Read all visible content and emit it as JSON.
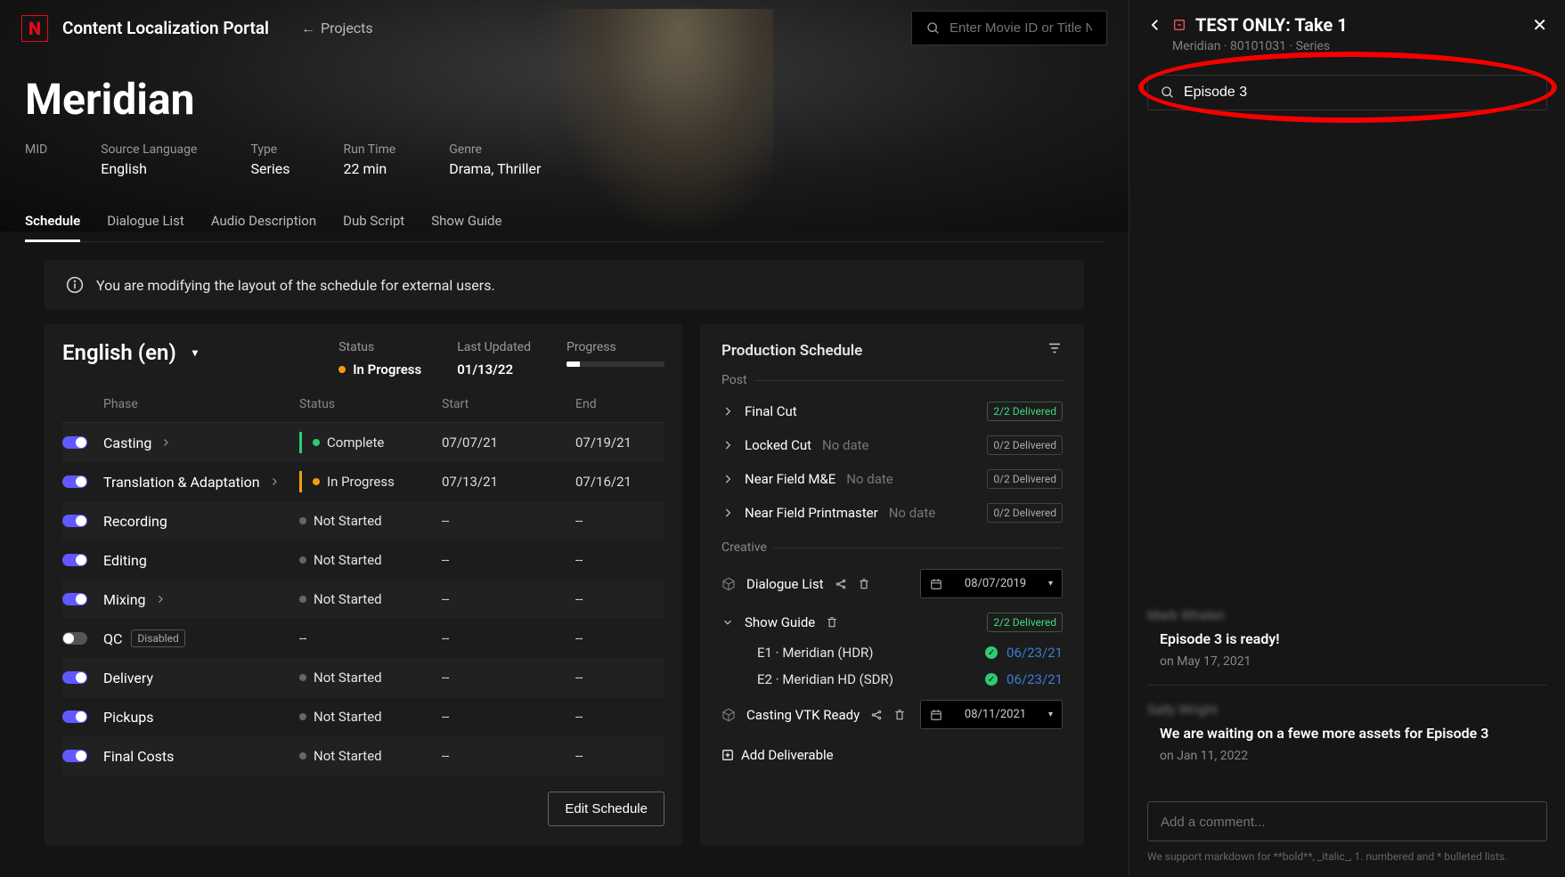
{
  "app": {
    "title": "Content Localization Portal",
    "projects_link": "Projects",
    "search_placeholder": "Enter Movie ID or Title Name"
  },
  "title": {
    "name": "Meridian",
    "meta": {
      "mid_label": "MID",
      "mid_value": "",
      "source_language_label": "Source Language",
      "source_language_value": "English",
      "type_label": "Type",
      "type_value": "Series",
      "runtime_label": "Run Time",
      "runtime_value": "22 min",
      "genre_label": "Genre",
      "genre_value": "Drama, Thriller"
    }
  },
  "tabs": {
    "schedule": "Schedule",
    "dialogue_list": "Dialogue List",
    "audio_description": "Audio Description",
    "dub_script": "Dub Script",
    "show_guide": "Show Guide"
  },
  "notice": "You are modifying the layout of the schedule for external users.",
  "schedule_panel": {
    "language": "English (en)",
    "status_label": "Status",
    "status_value": "In Progress",
    "last_updated_label": "Last Updated",
    "last_updated_value": "01/13/22",
    "progress_label": "Progress",
    "progress_pct": 14,
    "columns": {
      "phase": "Phase",
      "status": "Status",
      "start": "Start",
      "end": "End"
    },
    "phases": [
      {
        "name": "Casting",
        "status": "Complete",
        "start": "07/07/21",
        "end": "07/19/21",
        "enabled": true,
        "expandable": true,
        "dot": "green",
        "bar": "green"
      },
      {
        "name": "Translation & Adaptation",
        "status": "In Progress",
        "start": "07/13/21",
        "end": "07/16/21",
        "enabled": true,
        "expandable": true,
        "dot": "amber",
        "bar": "amber"
      },
      {
        "name": "Recording",
        "status": "Not Started",
        "start": "--",
        "end": "--",
        "enabled": true,
        "dot": "grey"
      },
      {
        "name": "Editing",
        "status": "Not Started",
        "start": "--",
        "end": "--",
        "enabled": true,
        "dot": "grey"
      },
      {
        "name": "Mixing",
        "status": "Not Started",
        "start": "--",
        "end": "--",
        "enabled": true,
        "expandable": true,
        "dot": "grey"
      },
      {
        "name": "QC",
        "status": "--",
        "start": "--",
        "end": "--",
        "enabled": false,
        "disabled_chip": "Disabled"
      },
      {
        "name": "Delivery",
        "status": "Not Started",
        "start": "--",
        "end": "--",
        "enabled": true,
        "dot": "grey"
      },
      {
        "name": "Pickups",
        "status": "Not Started",
        "start": "--",
        "end": "--",
        "enabled": true,
        "dot": "grey"
      },
      {
        "name": "Final Costs",
        "status": "Not Started",
        "start": "--",
        "end": "--",
        "enabled": true,
        "dot": "grey"
      }
    ],
    "edit_button": "Edit Schedule"
  },
  "production_panel": {
    "title": "Production Schedule",
    "sections": {
      "post_label": "Post",
      "post_items": [
        {
          "name": "Final Cut",
          "date": "",
          "badge": "2/2 Delivered",
          "badge_style": "ok"
        },
        {
          "name": "Locked Cut",
          "date": "No date",
          "badge": "0/2 Delivered",
          "badge_style": "muted"
        },
        {
          "name": "Near Field M&E",
          "date": "No date",
          "badge": "0/2 Delivered",
          "badge_style": "muted"
        },
        {
          "name": "Near Field Printmaster",
          "date": "No date",
          "badge": "0/2 Delivered",
          "badge_style": "muted"
        }
      ],
      "creative_label": "Creative",
      "dialogue_list": {
        "name": "Dialogue List",
        "date": "08/07/2019"
      },
      "show_guide": {
        "name": "Show Guide",
        "badge": "2/2 Delivered"
      },
      "episodes": [
        {
          "name": "E1 · Meridian (HDR)",
          "date": "06/23/21"
        },
        {
          "name": "E2 · Meridian HD (SDR)",
          "date": "06/23/21"
        }
      ],
      "casting_vtk": {
        "name": "Casting VTK Ready",
        "date": "08/11/2021"
      }
    },
    "add_deliverable": "Add Deliverable"
  },
  "side_panel": {
    "title": "TEST ONLY: Take 1",
    "subtitle": "Meridian · 80101031 · Series",
    "search_value": "Episode 3",
    "comments": [
      {
        "author": "Mark Whalen",
        "body": "Episode 3 is ready!",
        "date": "on May 17, 2021"
      },
      {
        "author": "Sally Wright",
        "body": "We are waiting on a fewe more assets for Episode 3",
        "date": "on Jan 11, 2022"
      }
    ],
    "comment_placeholder": "Add a comment...",
    "md_hint": "We support markdown for **bold**, _italic_, 1. numbered and * bulleted lists."
  }
}
